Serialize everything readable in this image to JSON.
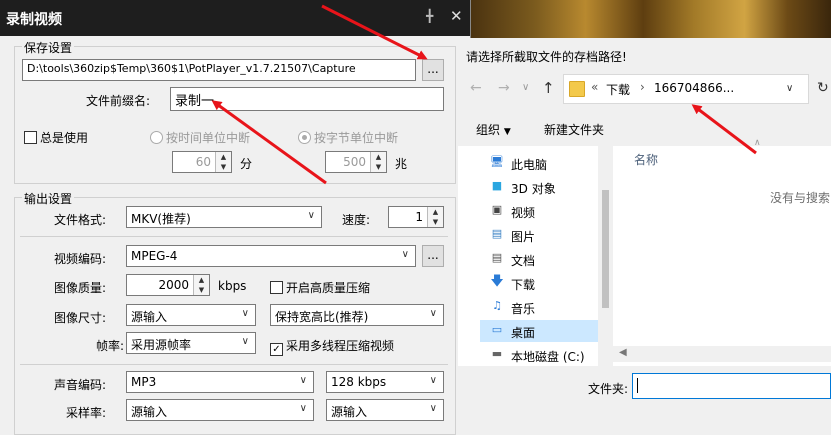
{
  "record_dialog": {
    "title": "录制视频",
    "save_group": "保存设置",
    "path_value": "D:\\tools\\360zip$Temp\\360$1\\PotPlayer_v1.7.21507\\Capture",
    "browse_label": "...",
    "prefix_label": "文件前缀名:",
    "prefix_value": "录制一",
    "always_use": "总是使用",
    "by_time": "按时间单位中断",
    "time_value": "60",
    "time_unit": "分",
    "by_size": "按字节单位中断",
    "size_value": "500",
    "size_unit": "兆",
    "output_group": "输出设置",
    "format_label": "文件格式:",
    "format_value": "MKV(推荐)",
    "speed_label": "速度:",
    "speed_value": "1",
    "vcodec_label": "视频编码:",
    "vcodec_value": "MPEG-4",
    "vcodec_btn": "...",
    "quality_label": "图像质量:",
    "quality_value": "2000",
    "quality_unit": "kbps",
    "hq_label": "开启高质量压缩",
    "size_label": "图像尺寸:",
    "size_sel": "源输入",
    "aspect_sel": "保持宽高比(推荐)",
    "fps_label": "帧率:",
    "fps_value": "采用源帧率",
    "mt_label": "采用多线程压缩视频",
    "acodec_label": "声音编码:",
    "acodec_value": "MP3",
    "abitrate_value": "128 kbps",
    "samplerate_label": "采样率:",
    "samplerate_value": "源输入",
    "channel_value": "源输入"
  },
  "file_dialog": {
    "prompt": "请选择所截取文件的存档路径!",
    "crumb_prefix": "«",
    "crumb_1": "下载",
    "crumb_sep": "›",
    "crumb_2": "166704866...",
    "organize": "组织",
    "new_folder": "新建文件夹",
    "col_name": "名称",
    "empty_text": "没有与搜索",
    "filename_label": "文件夹:",
    "tree": [
      {
        "label": "此电脑",
        "icon": "computer-icon"
      },
      {
        "label": "3D 对象",
        "icon": "cube-icon"
      },
      {
        "label": "视频",
        "icon": "video-icon"
      },
      {
        "label": "图片",
        "icon": "picture-icon"
      },
      {
        "label": "文档",
        "icon": "document-icon"
      },
      {
        "label": "下载",
        "icon": "download-icon"
      },
      {
        "label": "音乐",
        "icon": "music-icon"
      },
      {
        "label": "桌面",
        "icon": "desktop-icon"
      },
      {
        "label": "本地磁盘 (C:)",
        "icon": "disk-icon"
      }
    ]
  },
  "colors": {
    "annotation_arrow": "#e8141a",
    "title_bar": "#1e1e1e",
    "selected_tree": "#cce8ff"
  }
}
